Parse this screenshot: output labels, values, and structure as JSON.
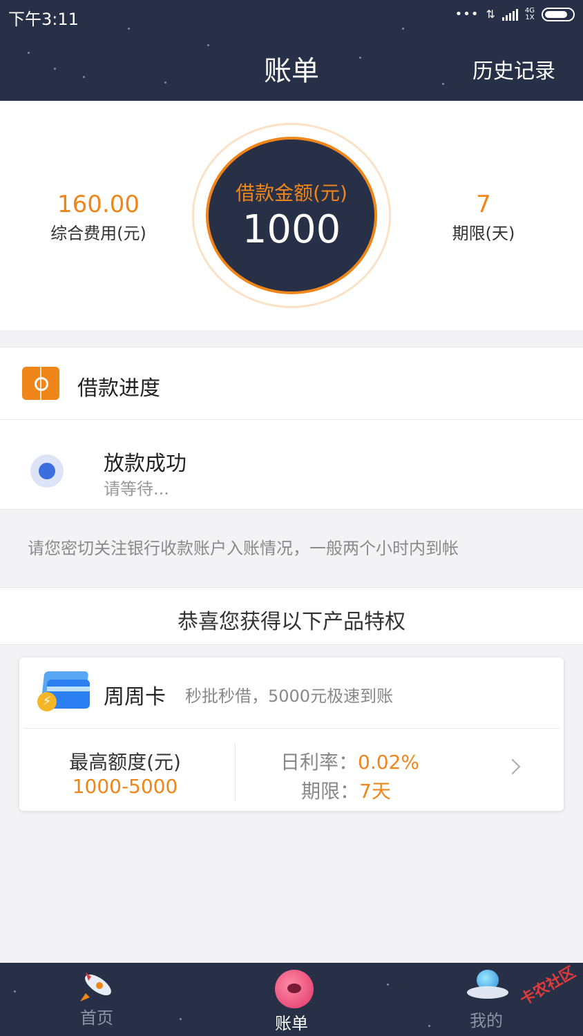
{
  "status_bar": {
    "time": "下午3:11",
    "network_top": "4G",
    "network_bottom": "1X"
  },
  "header": {
    "title": "账单",
    "history_link": "历史记录"
  },
  "summary": {
    "fee_value": "160.00",
    "fee_label": "综合费用(元)",
    "loan_label": "借款金额(元)",
    "loan_value": "1000",
    "term_value": "7",
    "term_label": "期限(天)"
  },
  "progress": {
    "title": "借款进度",
    "step_title": "放款成功",
    "step_subtitle": "请等待..."
  },
  "notice": "请您密切关注银行收款账户入账情况，一般两个小时内到帐",
  "privilege": {
    "title": "恭喜您获得以下产品特权"
  },
  "card": {
    "name": "周周卡",
    "description": "秒批秒借，5000元极速到账",
    "limit_label": "最高额度(元)",
    "limit_value": "1000-5000",
    "rate_label": "日利率：",
    "rate_value": "0.02%",
    "term_label": "期限：",
    "term_value": "7天"
  },
  "bottom_nav": {
    "home": "首页",
    "bill": "账单",
    "mine": "我的"
  },
  "watermark": "卡农社区",
  "colors": {
    "navy": "#273047",
    "accent": "#f08519",
    "blue": "#3d6ee0"
  }
}
